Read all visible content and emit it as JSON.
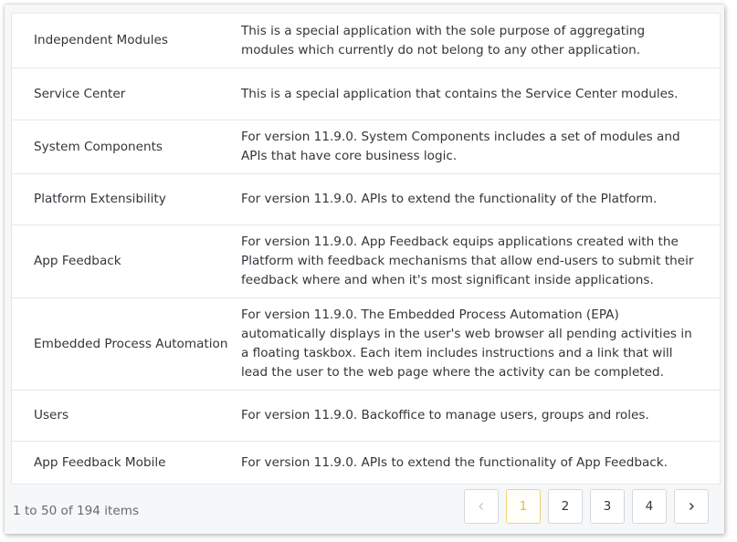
{
  "table": {
    "rows": [
      {
        "name": "Independent Modules",
        "description": "This is a special application with the sole purpose of aggregating modules which currently do not belong to any other application."
      },
      {
        "name": "Service Center",
        "description": "This is a special application that contains the Service Center modules."
      },
      {
        "name": "System Components",
        "description": "For version 11.9.0. System Components includes a set of modules and APIs that have core business logic."
      },
      {
        "name": "Platform Extensibility",
        "description": "For version 11.9.0. APIs to extend the functionality of the Platform."
      },
      {
        "name": "App Feedback",
        "description": "For version 11.9.0. App Feedback equips applications created with the Platform with feedback mechanisms that allow end-users to submit their feedback where and when it's most significant inside applications."
      },
      {
        "name": "Embedded Process Automation",
        "description": "For version 11.9.0. The Embedded Process Automation (EPA) automatically displays in the user's web browser all pending activities in a floating taskbox. Each item includes instructions and a link that will lead the user to the web page where the activity can be completed."
      },
      {
        "name": "Users",
        "description": "For version 11.9.0. Backoffice to manage users, groups and roles."
      },
      {
        "name": "App Feedback Mobile",
        "description": "For version 11.9.0. APIs to extend the functionality of App Feedback."
      }
    ]
  },
  "footer": {
    "count_text": "1 to 50 of 194 items"
  },
  "pagination": {
    "prev_icon": "chevron-left-icon",
    "next_icon": "chevron-right-icon",
    "pages": [
      "1",
      "2",
      "3",
      "4"
    ],
    "active_page": "1"
  },
  "colors": {
    "active_border": "#f0d27a",
    "active_text": "#e8b84a",
    "text": "#31363b",
    "border": "#e6e8eb"
  }
}
